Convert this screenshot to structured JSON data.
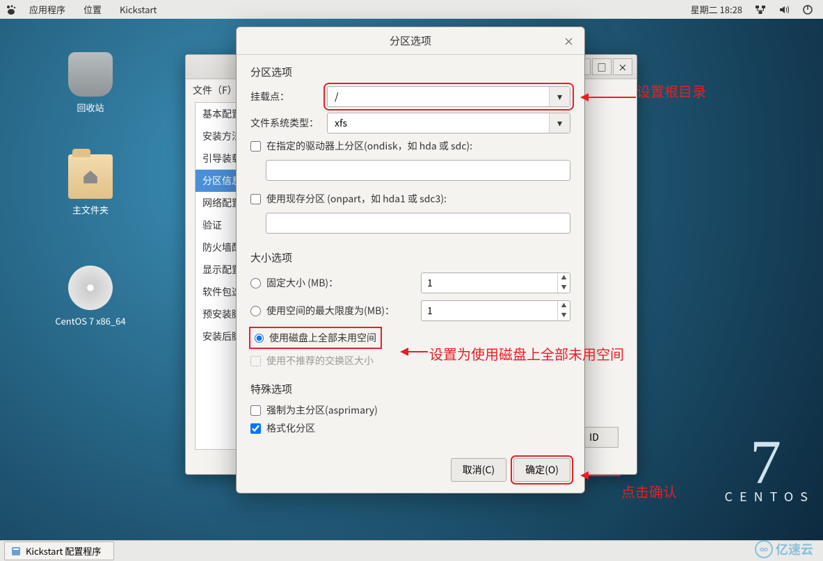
{
  "topbar": {
    "menu_apps": "应用程序",
    "menu_places": "位置",
    "menu_kickstart": "Kickstart",
    "clock": "星期二 18:28"
  },
  "desktop": {
    "trash_label": "回收站",
    "home_label": "主文件夹",
    "disc_label": "CentOS 7 x86_64",
    "logo_7": "7",
    "logo_sub": "CENTOS"
  },
  "bgwin": {
    "file_menu": "文件（F）",
    "sidebar": [
      "基本配置",
      "安装方法",
      "引导装载",
      "分区信息",
      "网络配置",
      "验证",
      "防火墙配",
      "显示配置",
      "软件包选",
      "预安装脚",
      "安装后脚"
    ],
    "selected_index": 3,
    "raid_btn": "ID"
  },
  "dialog": {
    "title": "分区选项",
    "section_partition": "分区选项",
    "mount_label": "挂载点：",
    "mount_value": "/",
    "fstype_label": "文件系统类型：",
    "fstype_value": "xfs",
    "ondisk_label": "在指定的驱动器上分区(ondisk，如 hda 或 sdc):",
    "onpart_label": "使用现存分区 (onpart，如 hda1 或 sdc3):",
    "section_size": "大小选项",
    "fixed_label": "固定大小 (MB)：",
    "fixed_value": "1",
    "maxsize_label": "使用空间的最大限度为(MB)：",
    "maxsize_value": "1",
    "grow_label": "使用磁盘上全部未用空间",
    "recswap_label": "使用不推荐的交换区大小",
    "section_special": "特殊选项",
    "asprimary_label": "强制为主分区(asprimary)",
    "format_label": "格式化分区",
    "cancel_btn": "取消(C)",
    "ok_btn": "确定(O)"
  },
  "annotations": {
    "a1": "设置根目录",
    "a2": "设置为使用磁盘上全部未用空间",
    "a3": "点击确认"
  },
  "taskbar": {
    "task1": "Kickstart 配置程序"
  },
  "watermark": {
    "text": "亿速云"
  }
}
